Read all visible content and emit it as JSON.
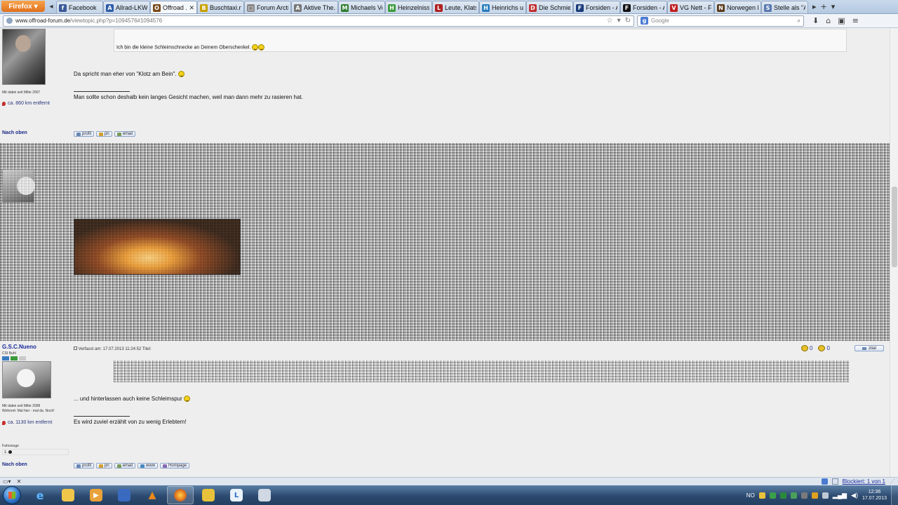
{
  "browser": {
    "app_menu_label": "Firefox",
    "tabs": [
      {
        "label": "Facebook",
        "icon": "facebook-icon",
        "color": "#3b5998",
        "glyph": "f"
      },
      {
        "label": "Allrad-LKW...",
        "icon": "page-icon",
        "color": "#2d5ca8",
        "glyph": "A"
      },
      {
        "label": "Offroad ...",
        "icon": "page-icon",
        "color": "#7a4a1a",
        "glyph": "O",
        "active": true
      },
      {
        "label": "Buschtaxi.n...",
        "icon": "page-icon",
        "color": "#c8a000",
        "glyph": "B"
      },
      {
        "label": "Forum Arcti...",
        "icon": "page-icon",
        "color": "#888888",
        "glyph": "□"
      },
      {
        "label": "Aktive The...",
        "icon": "page-icon",
        "color": "#777777",
        "glyph": "A"
      },
      {
        "label": "Michaels Vo...",
        "icon": "page-icon",
        "color": "#2f7d2f",
        "glyph": "M"
      },
      {
        "label": "Heinzelniss...",
        "icon": "page-icon",
        "color": "#3a9a3a",
        "glyph": "H"
      },
      {
        "label": "Leute, Klats...",
        "icon": "page-icon",
        "color": "#b02020",
        "glyph": "L"
      },
      {
        "label": "Heinrichs u...",
        "icon": "page-icon",
        "color": "#2a7fc0",
        "glyph": "H"
      },
      {
        "label": "Die Schmier...",
        "icon": "page-icon",
        "color": "#c03030",
        "glyph": "D"
      },
      {
        "label": "Forsiden - A...",
        "icon": "page-icon",
        "color": "#1a3a7a",
        "glyph": "F"
      },
      {
        "label": "Forsiden - A...",
        "icon": "page-icon",
        "color": "#111111",
        "glyph": "F"
      },
      {
        "label": "VG Nett - F...",
        "icon": "page-icon",
        "color": "#c02020",
        "glyph": "V"
      },
      {
        "label": "Norwegen F...",
        "icon": "page-icon",
        "color": "#5a3a1a",
        "glyph": "N"
      },
      {
        "label": "Stelle als \"A...",
        "icon": "page-icon",
        "color": "#5a7ab0",
        "glyph": "S"
      }
    ],
    "url_host": "www.offroad-forum.de",
    "url_path": "/viewtopic.php?p=1094576#1094576",
    "search_placeholder": "Google"
  },
  "posts": {
    "first": {
      "quote_text": "Ich bin die kleine Schleimschnecke an Deinem Oberschenkel.",
      "body_text": "Da spricht man eher von \"Klotz am Bein\".",
      "signature": "Man sollte schon deshalb kein langes Gesicht machen, weil man dann mehr zu rasieren hat.",
      "member_since": "Mit dabei seit Mitte 2007",
      "distance": "ca. 860 km entfernt",
      "back_to_top": "Nach oben",
      "buttons": [
        "profil",
        "pn",
        "email"
      ]
    },
    "third": {
      "username": "G.S.C.Nueno",
      "rank": "CSI Buhl",
      "post_meta": "Verfasst am: 17.07.2013 11:24:52    Titel:",
      "rating_up": "0",
      "rating_down": "0",
      "quote_button": "zitat",
      "body_text": "... und hinterlassen auch keine Schleimspur",
      "signature": "Es wird zuviel erzählt von zu wenig Erlebtem!",
      "member_since": "Mit dabei seit Mitte 2008",
      "residence": "Wohnort: Mal hier - mal da. Noch!",
      "distance": "ca. 1130 km entfernt",
      "vehicles_label": "Fahrzeuge",
      "vehicles_value": "1.",
      "back_to_top": "Nach oben",
      "buttons": [
        "profil",
        "pn",
        "email",
        "www",
        "Hompage"
      ]
    }
  },
  "addonbar": {
    "blocked_text": "Blockiert: 1 von 1"
  },
  "taskbar": {
    "language": "NO",
    "time": "12:36",
    "date": "17.07.2013"
  },
  "colors": {
    "link_blue": "#1a2a86",
    "firefox_orange": "#e0701c",
    "page_bg": "#eeeeee"
  }
}
